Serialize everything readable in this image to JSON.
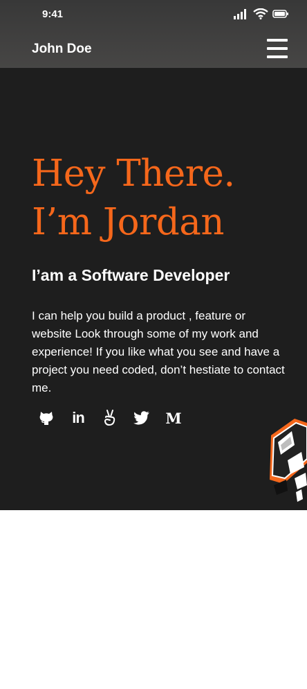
{
  "status_bar": {
    "time": "9:41",
    "icons": [
      "signal-icon",
      "wifi-icon",
      "battery-icon"
    ]
  },
  "header": {
    "brand": "John Doe",
    "menu_icon": "hamburger-menu-icon"
  },
  "hero": {
    "title_line1": "Hey There.",
    "title_line2": "I’m Jordan",
    "subtitle": "I’am a Software Developer",
    "intro": "I can help you build a product , feature or website Look through some of my work and experience! If you like what you see and have a project you need coded, don’t hestiate to contact me."
  },
  "socials": {
    "icons": [
      "github-icon",
      "linkedin-icon",
      "angellist-icon",
      "twitter-icon",
      "medium-icon"
    ],
    "linkedin_glyph": "in",
    "medium_glyph": "M"
  },
  "colors": {
    "accent": "#f5671b",
    "background": "#1e1e1e",
    "header": "#474645",
    "text": "#ffffff"
  }
}
